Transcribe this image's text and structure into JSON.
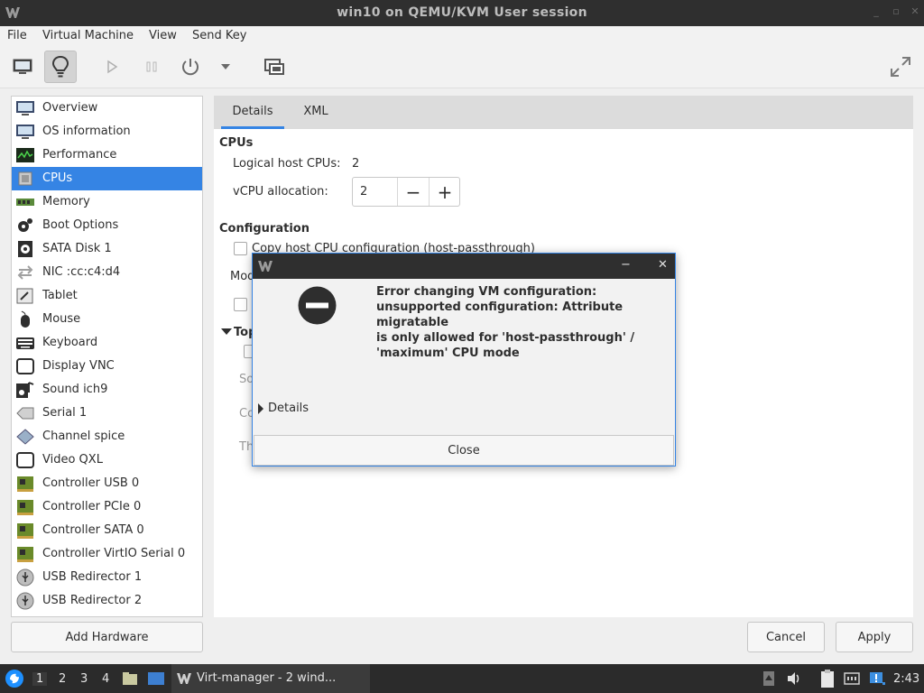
{
  "window": {
    "title": "win10 on QEMU/KVM User session"
  },
  "menu": [
    "File",
    "Virtual Machine",
    "View",
    "Send Key"
  ],
  "toolbar": {
    "buttons": [
      "console-icon",
      "details-lightbulb-icon",
      "run-icon",
      "pause-icon",
      "power-icon",
      "power-menu-chevron-icon",
      "snapshot-icon",
      "fullscreen-icon"
    ]
  },
  "sidebar": {
    "selected_index": 3,
    "items": [
      {
        "label": "Overview",
        "icon": "monitor-icon"
      },
      {
        "label": "OS information",
        "icon": "monitor-info-icon"
      },
      {
        "label": "Performance",
        "icon": "performance-graph-icon"
      },
      {
        "label": "CPUs",
        "icon": "cpu-chip-icon"
      },
      {
        "label": "Memory",
        "icon": "memory-icon"
      },
      {
        "label": "Boot Options",
        "icon": "gear-icon"
      },
      {
        "label": "SATA Disk 1",
        "icon": "disk-icon"
      },
      {
        "label": "NIC :cc:c4:d4",
        "icon": "network-arrows-icon"
      },
      {
        "label": "Tablet",
        "icon": "tablet-icon"
      },
      {
        "label": "Mouse",
        "icon": "mouse-icon"
      },
      {
        "label": "Keyboard",
        "icon": "keyboard-icon"
      },
      {
        "label": "Display VNC",
        "icon": "display-icon"
      },
      {
        "label": "Sound ich9",
        "icon": "sound-icon"
      },
      {
        "label": "Serial 1",
        "icon": "serial-icon"
      },
      {
        "label": "Channel spice",
        "icon": "channel-icon"
      },
      {
        "label": "Video QXL",
        "icon": "video-icon"
      },
      {
        "label": "Controller USB 0",
        "icon": "controller-card-icon"
      },
      {
        "label": "Controller PCIe 0",
        "icon": "controller-card-icon"
      },
      {
        "label": "Controller SATA 0",
        "icon": "controller-card-icon"
      },
      {
        "label": "Controller VirtIO Serial 0",
        "icon": "controller-card-icon"
      },
      {
        "label": "USB Redirector 1",
        "icon": "usb-icon"
      },
      {
        "label": "USB Redirector 2",
        "icon": "usb-icon"
      }
    ],
    "add_hardware": "Add Hardware"
  },
  "tabs": [
    {
      "label": "Details"
    },
    {
      "label": "XML"
    }
  ],
  "cpus": {
    "heading": "CPUs",
    "logical_label": "Logical host CPUs:",
    "logical_value": "2",
    "vcpu_label": "vCPU allocation:",
    "vcpu_value": "2",
    "minus": "−",
    "plus": "+"
  },
  "configuration": {
    "heading": "Configuration",
    "copy_host_label": "Copy host CPU configuration (host-passthrough)",
    "model_label_partial": "Mod",
    "topology_partial": "Top",
    "partial_so": "So",
    "partial_co": "Co",
    "partial_th": "Th"
  },
  "buttons": {
    "cancel": "Cancel",
    "apply": "Apply"
  },
  "dialog": {
    "message": "Error changing VM configuration:\nunsupported configuration: Attribute\nmigratable\nis only allowed for 'host-passthrough' /\n'maximum' CPU mode",
    "details": "Details",
    "close": "Close"
  },
  "taskbar": {
    "workspaces": [
      "1",
      "2",
      "3",
      "4"
    ],
    "active_workspace": "1",
    "task_label": "Virt-manager - 2 wind...",
    "clock": "2:43"
  }
}
